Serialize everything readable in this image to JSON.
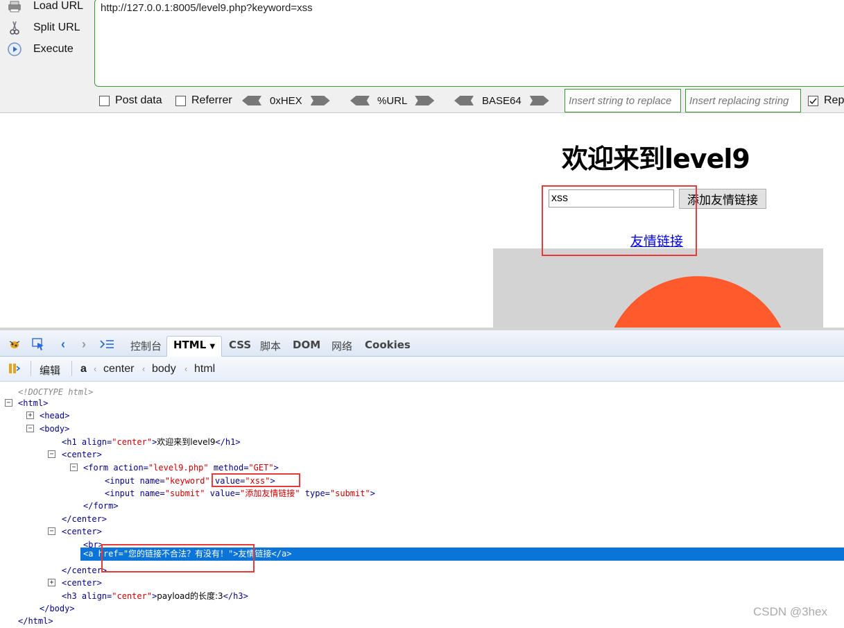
{
  "hackbar": {
    "load_url": "Load URL",
    "split_url": "Split URL",
    "execute": "Execute",
    "url_value": "http://127.0.0.1:8005/level9.php?keyword=xss",
    "post_data": "Post data",
    "referrer": "Referrer",
    "enc_hex": "0xHEX",
    "enc_url": "%URL",
    "enc_base64": "BASE64",
    "insert_replace_placeholder": "Insert string to replace",
    "insert_replacing_placeholder": "Insert replacing string",
    "replace_all": "Rep"
  },
  "page": {
    "heading": "欢迎来到level9",
    "keyword_value": "xss",
    "submit_label": "添加友情链接",
    "link_text": "友情链接"
  },
  "devtools": {
    "tabs": [
      "控制台",
      "HTML",
      "CSS",
      "脚本",
      "DOM",
      "网络",
      "Cookies"
    ],
    "edit_label": "编辑",
    "breadcrumb": [
      "a",
      "center",
      "body",
      "html"
    ],
    "tree": {
      "doctype": "<!DOCTYPE html>",
      "html_open": "<html>",
      "head": "<head>",
      "body_open": "<body>",
      "h1_tag": "<h1",
      "h1_attr": " align=",
      "h1_val": "\"center\"",
      "h1_text": "欢迎来到level9",
      "h1_close": "</h1>",
      "center_open": "<center>",
      "form_tag": "<form",
      "form_action_attr": " action=",
      "form_action_val": "\"level9.php\"",
      "form_method_attr": " method=",
      "form_method_val": "\"GET\"",
      "input1_tag": "<input",
      "input1_name_attr": " name=",
      "input1_name_val": "\"keyword\"",
      "input1_value_attr": " value=",
      "input1_value_val": "\"xss\"",
      "input2_tag": "<input",
      "input2_name_attr": " name=",
      "input2_name_val": "\"submit\"",
      "input2_value_attr": " value=",
      "input2_value_val": "\"添加友情链接\"",
      "input2_type_attr": " type=",
      "input2_type_val": "\"submit\"",
      "form_close": "</form>",
      "center_close": "</center>",
      "br": "<br>",
      "a_tag": "<a",
      "a_href_attr": " href=",
      "a_href_val": "\"您的链接不合法？有没有！\"",
      "a_text": "友情链接",
      "a_close": "</a>",
      "h3_tag": "<h3",
      "h3_attr": " align=",
      "h3_val": "\"center\"",
      "h3_text": "payload的长度:3",
      "h3_close": "</h3>",
      "body_close": "</body>",
      "html_close": "</html>"
    }
  },
  "watermark": "CSDN @3hex"
}
